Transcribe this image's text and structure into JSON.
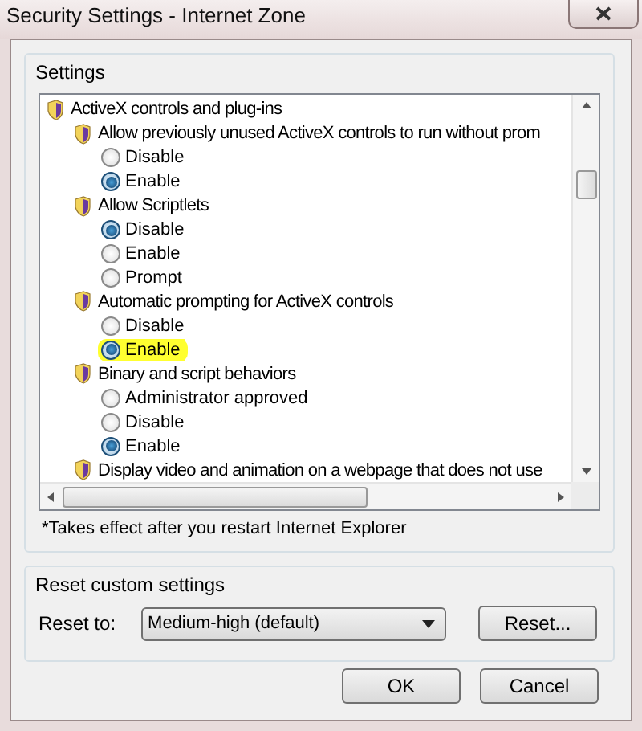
{
  "window": {
    "title": "Security Settings - Internet Zone"
  },
  "settings": {
    "label": "Settings",
    "tree": [
      {
        "label": "ActiveX controls and plug-ins",
        "children": [
          {
            "label": "Allow previously unused ActiveX controls to run without prom",
            "options": [
              {
                "label": "Disable",
                "selected": false,
                "highlighted": false
              },
              {
                "label": "Enable",
                "selected": true,
                "highlighted": false
              }
            ]
          },
          {
            "label": "Allow Scriptlets",
            "options": [
              {
                "label": "Disable",
                "selected": true,
                "highlighted": false
              },
              {
                "label": "Enable",
                "selected": false,
                "highlighted": false
              },
              {
                "label": "Prompt",
                "selected": false,
                "highlighted": false
              }
            ]
          },
          {
            "label": "Automatic prompting for ActiveX controls",
            "options": [
              {
                "label": "Disable",
                "selected": false,
                "highlighted": false
              },
              {
                "label": "Enable",
                "selected": true,
                "highlighted": true
              }
            ]
          },
          {
            "label": "Binary and script behaviors",
            "options": [
              {
                "label": "Administrator approved",
                "selected": false,
                "highlighted": false
              },
              {
                "label": "Disable",
                "selected": false,
                "highlighted": false
              },
              {
                "label": "Enable",
                "selected": true,
                "highlighted": false
              }
            ]
          },
          {
            "label": "Display video and animation on a webpage that does not use"
          }
        ]
      }
    ],
    "note": "*Takes effect after you restart Internet Explorer"
  },
  "reset": {
    "label": "Reset custom settings",
    "field_label": "Reset to:",
    "value": "Medium-high (default)",
    "button": "Reset..."
  },
  "buttons": [
    "OK",
    "Cancel"
  ]
}
